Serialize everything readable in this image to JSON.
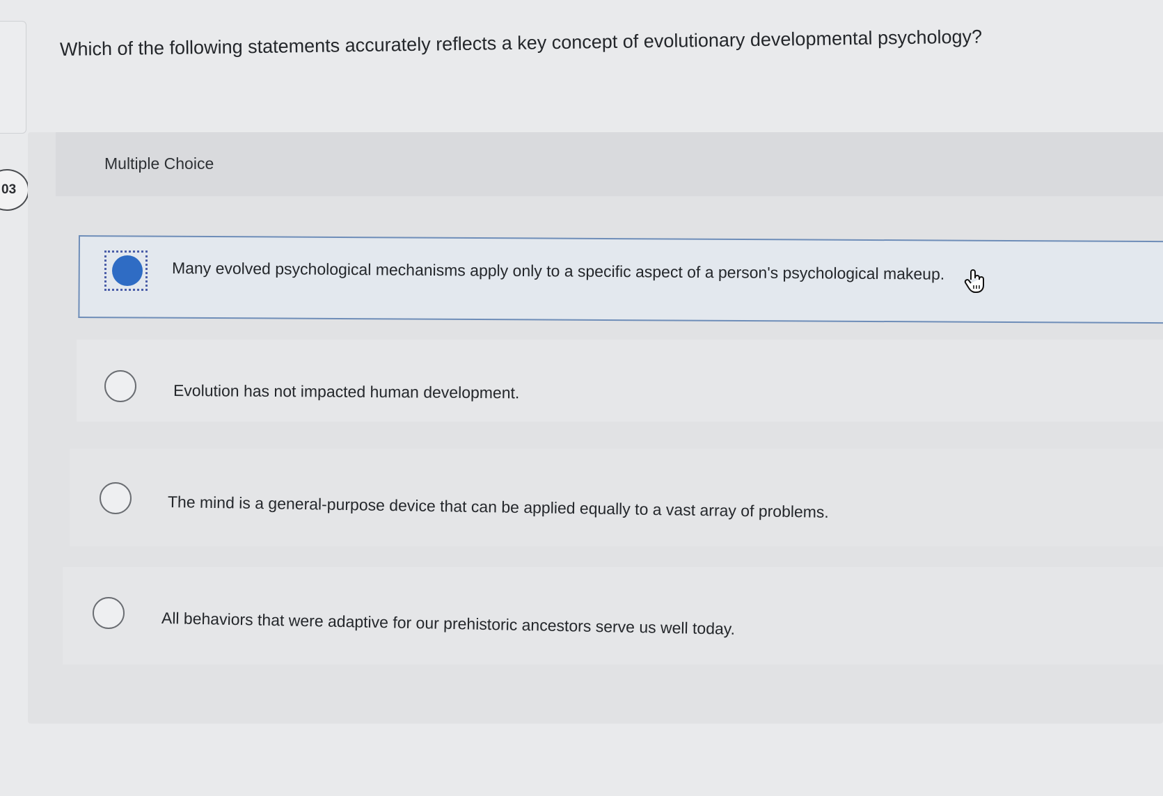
{
  "question_number": "03",
  "question": "Which of the following statements accurately reflects a key concept of evolutionary developmental psychology?",
  "section_label": "Multiple Choice",
  "options": [
    {
      "label": "Many evolved psychological mechanisms apply only to a specific aspect of a person's psychological makeup.",
      "selected": true
    },
    {
      "label": "Evolution has not impacted human development.",
      "selected": false
    },
    {
      "label": "The mind is a general-purpose device that can be applied equally to a vast array of problems.",
      "selected": false
    },
    {
      "label": "All behaviors that were adaptive for our prehistoric ancestors serve us well today.",
      "selected": false
    }
  ],
  "colors": {
    "selected_radio": "#2f6cc4",
    "selected_border": "#6e8db8",
    "focus_ring": "#4b5ea8"
  },
  "icons": {
    "cursor": "hand-pointer-icon"
  }
}
